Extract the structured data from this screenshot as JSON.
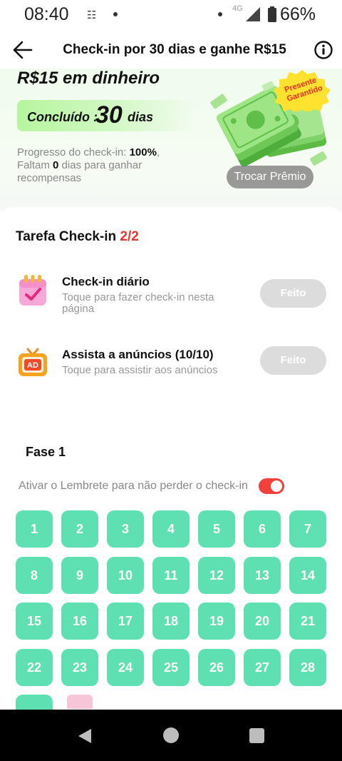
{
  "status_bar": {
    "time": "08:40",
    "network": "4G",
    "battery": "66%"
  },
  "header": {
    "title": "Check-in por 30 dias e ganhe R$15"
  },
  "hero": {
    "heading": "R$15 em dinheiro",
    "concluded_label": "Concluído :",
    "concluded_days": "30",
    "concluded_unit": "dias",
    "progress_line1_prefix": "Progresso do check-in: ",
    "progress_percent": "100%",
    "progress_line1_suffix": ",",
    "progress_line2_prefix": "Faltam ",
    "progress_remaining": "0",
    "progress_line2_suffix": " dias para ganhar recompensas",
    "badge": [
      "Presente",
      "Garantido"
    ],
    "redeem_button": "Trocar Prêmio"
  },
  "tasks": {
    "title": "Tarefa Check-in",
    "count": "2/2",
    "items": [
      {
        "title": "Check-in diário",
        "subtitle": "Toque para fazer check-in nesta página",
        "button": "Feito",
        "icon": "calendar-check-icon"
      },
      {
        "title": "Assista a anúncios  (10/10)",
        "subtitle": "Toque para assistir aos anúncios",
        "button": "Feito",
        "icon": "ad-tv-icon"
      }
    ]
  },
  "phase": {
    "title": "Fase 1",
    "reminder_text": "Ativar o Lembrete para não perder o check-in",
    "reminder_on": true,
    "days": [
      "1",
      "2",
      "3",
      "4",
      "5",
      "6",
      "7",
      "8",
      "9",
      "10",
      "11",
      "12",
      "13",
      "14",
      "15",
      "16",
      "17",
      "18",
      "19",
      "20",
      "21",
      "22",
      "23",
      "24",
      "25",
      "26",
      "27",
      "28"
    ]
  },
  "colors": {
    "accent_red": "#e8342e",
    "day_tile": "#5ee0b2",
    "done_button": "#dcdcdc"
  }
}
